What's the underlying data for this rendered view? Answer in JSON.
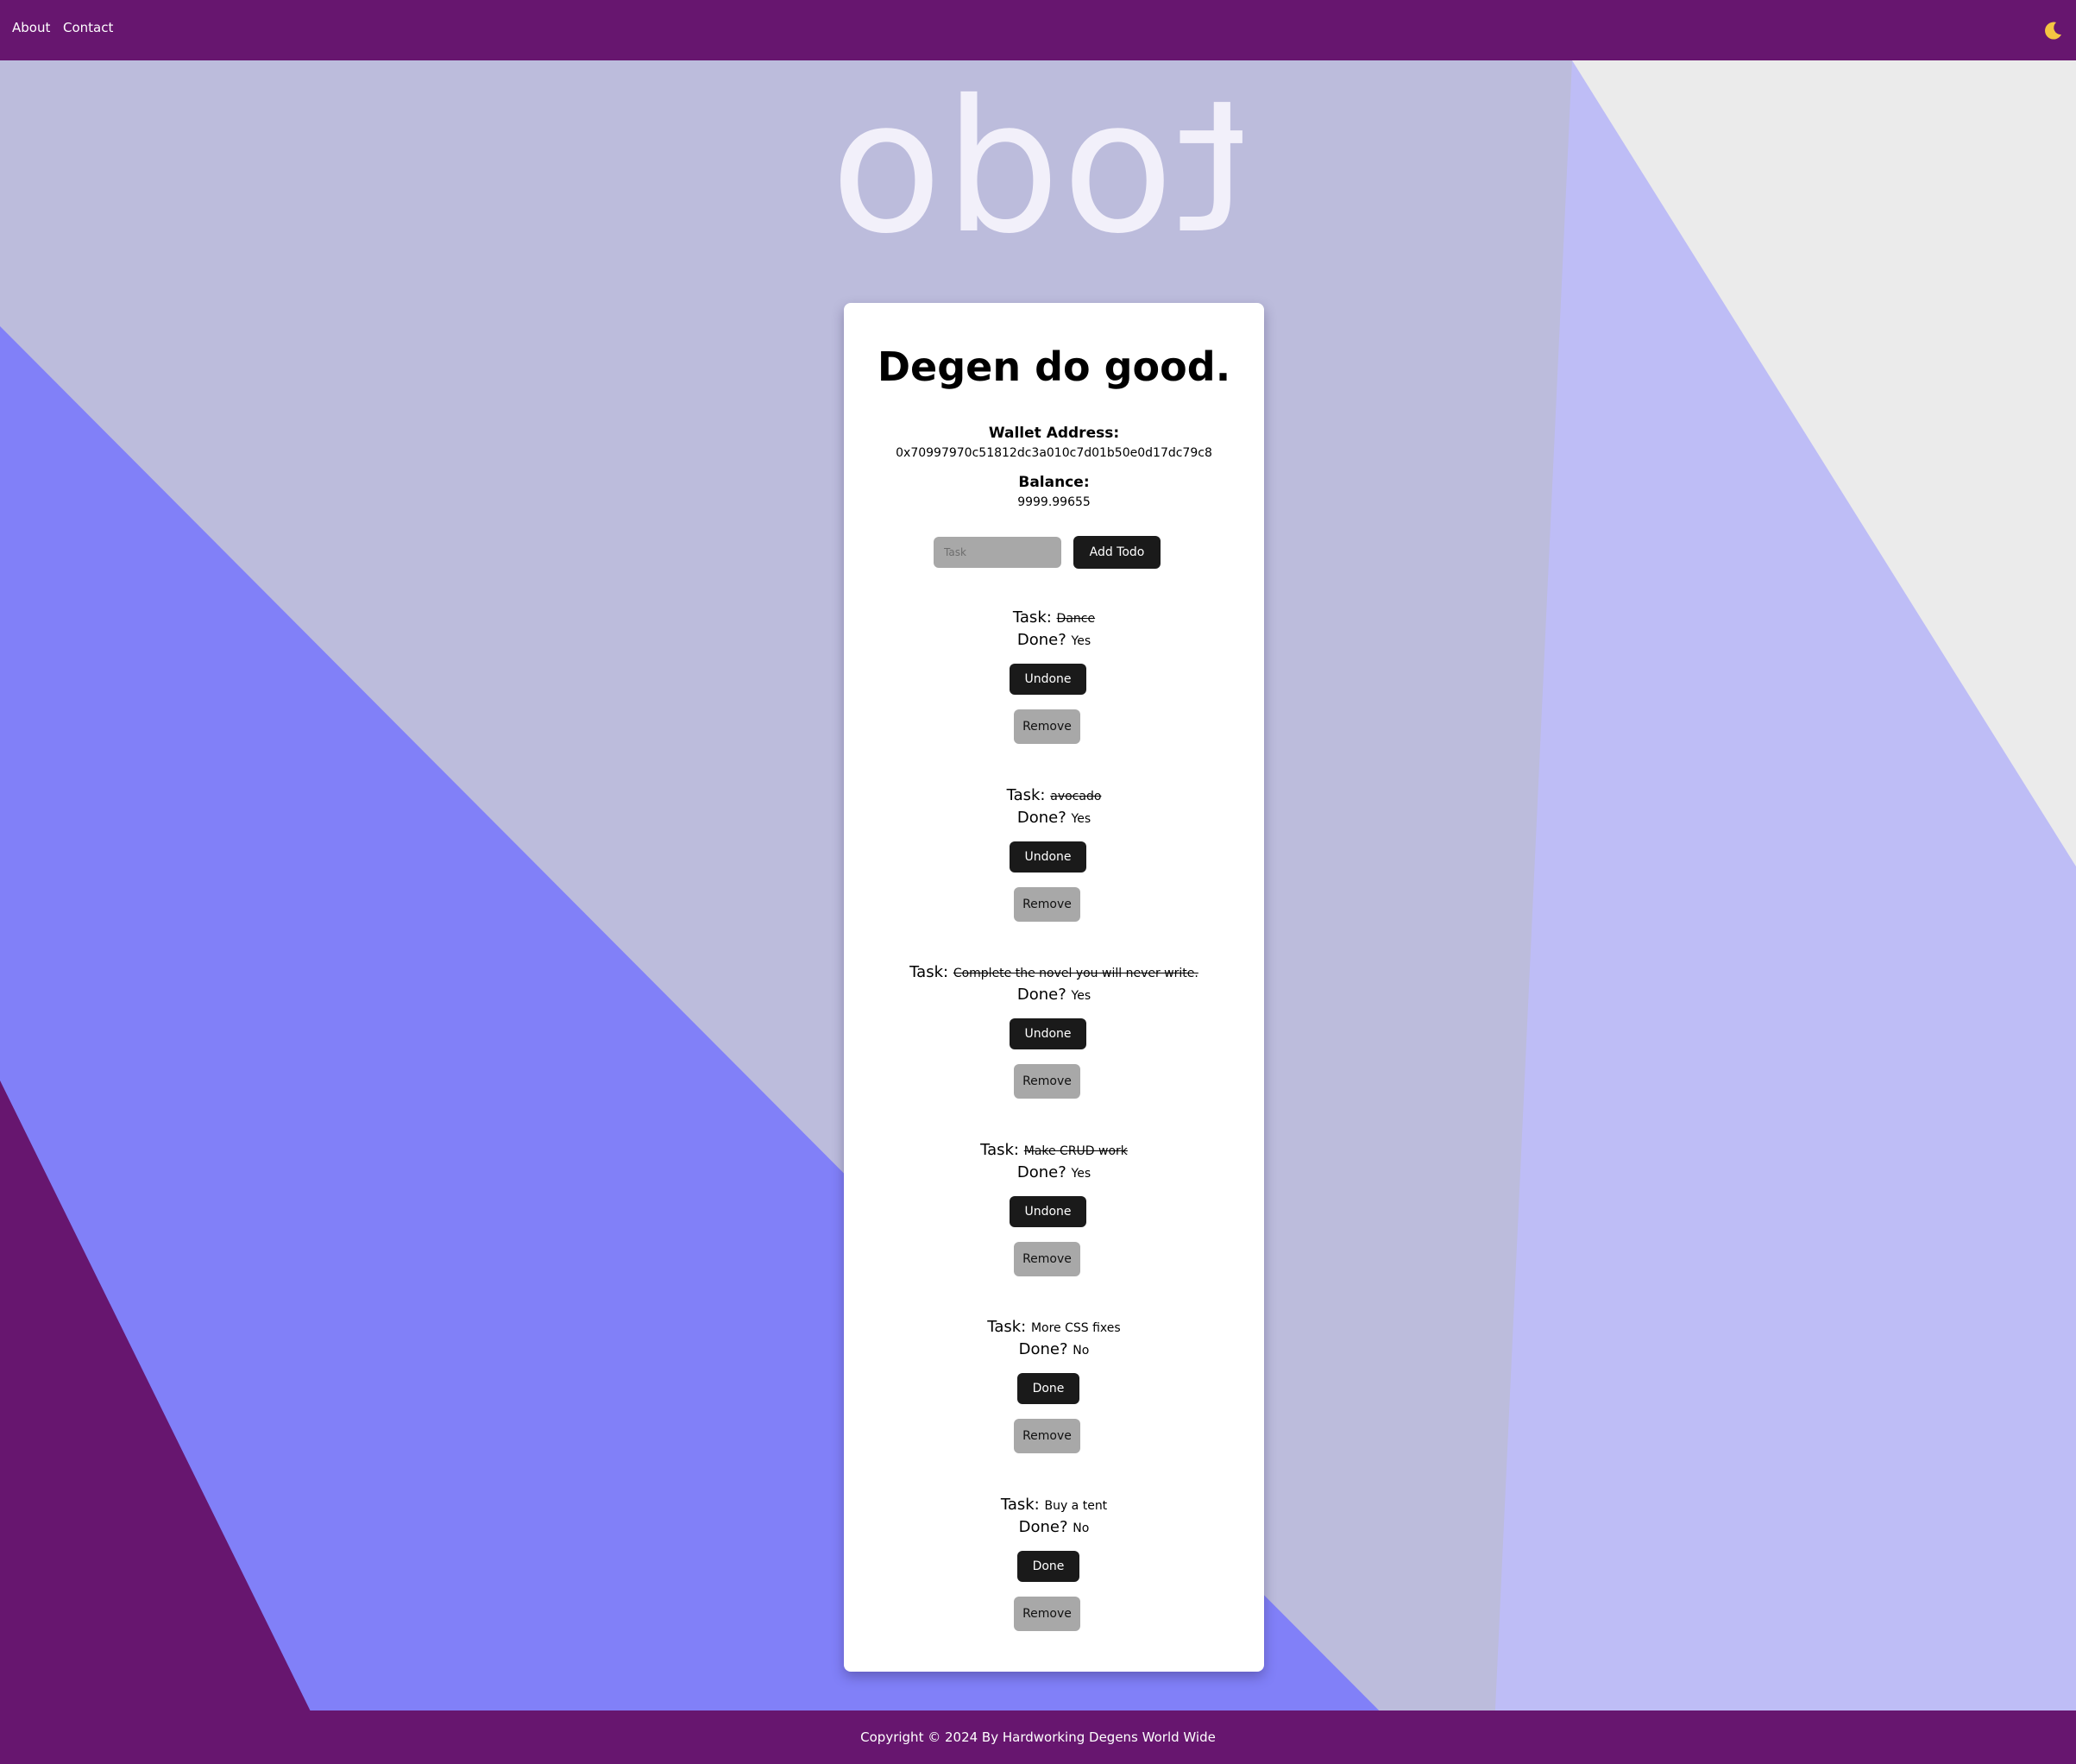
{
  "nav": {
    "about_label": "About",
    "contact_label": "Contact",
    "theme_icon": "moon-icon"
  },
  "hero": {
    "title": "todo"
  },
  "card": {
    "title": "Degen do good.",
    "wallet_label": "Wallet Address:",
    "wallet_address": "0x70997970c51812dc3a010c7d01b50e0d17dc79c8",
    "balance_label": "Balance:",
    "balance_value": "9999.99655",
    "task_placeholder": "Task",
    "add_button_label": "Add Todo"
  },
  "todo_labels": {
    "task_prefix": "Task:",
    "done_prefix": "Done?",
    "remove_label": "Remove"
  },
  "todos": [
    {
      "task": "Dance",
      "done": "Yes",
      "is_done": true,
      "action_label": "Undone"
    },
    {
      "task": "avocado",
      "done": "Yes",
      "is_done": true,
      "action_label": "Undone"
    },
    {
      "task": "Complete the novel you will never write.",
      "done": "Yes",
      "is_done": true,
      "action_label": "Undone"
    },
    {
      "task": "Make CRUD work",
      "done": "Yes",
      "is_done": true,
      "action_label": "Undone"
    },
    {
      "task": "More CSS fixes",
      "done": "No",
      "is_done": false,
      "action_label": "Done"
    },
    {
      "task": "Buy a tent",
      "done": "No",
      "is_done": false,
      "action_label": "Done"
    }
  ],
  "footer": {
    "text": "Copyright © 2024 By Hardworking Degens World Wide"
  },
  "colors": {
    "header_purple": "#67166f",
    "lavender_band": "#bcbcdc",
    "periwinkle_band": "#8180f8",
    "light_periwinkle_band": "#bebdf6",
    "grey_corner": "#ebebeb",
    "dark_button": "#1a1a1a",
    "grey_button": "#a8a8a8"
  }
}
